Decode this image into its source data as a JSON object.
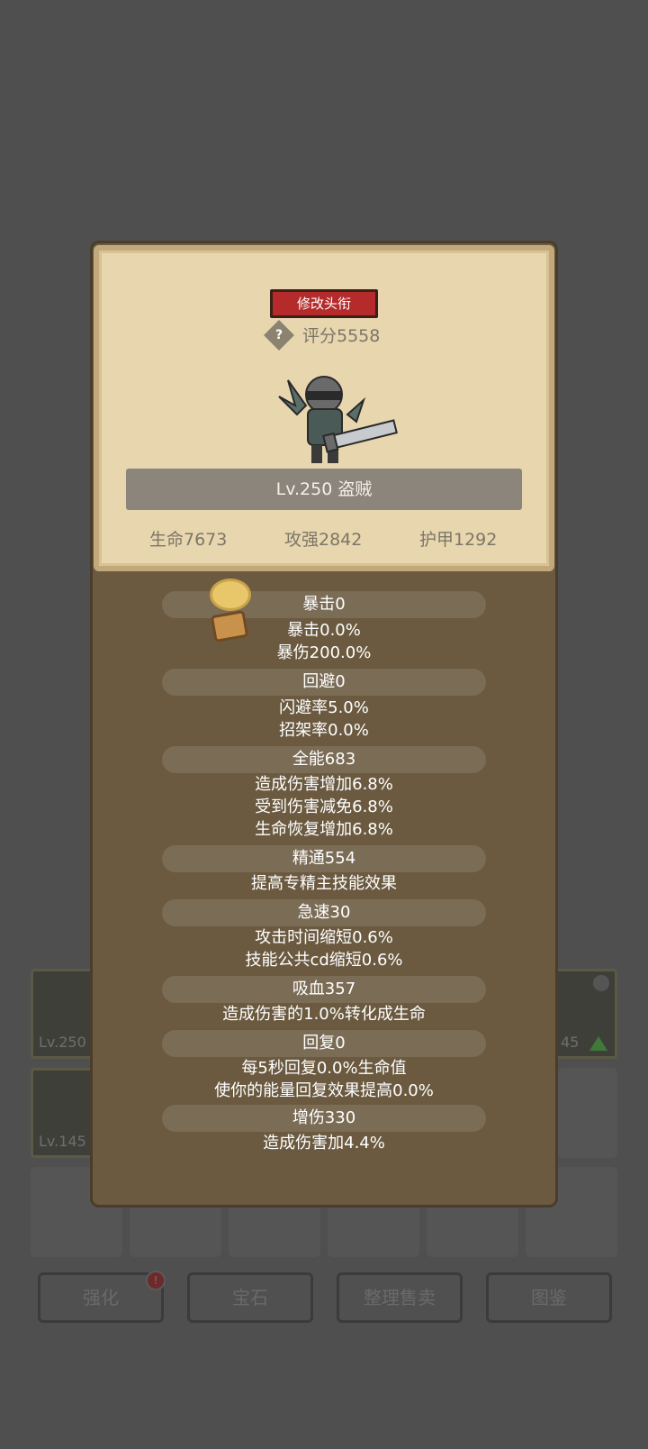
{
  "header": {
    "title_button": "修改头衔",
    "score_help": "?",
    "score": "评分5558"
  },
  "hero": {
    "level_class": "Lv.250 盗贼",
    "hp": "生命7673",
    "attack": "攻强2842",
    "armor": "护甲1292"
  },
  "attributes": [
    {
      "name": "暴击0",
      "lines": [
        "暴击0.0%",
        "暴伤200.0%"
      ]
    },
    {
      "name": "回避0",
      "lines": [
        "闪避率5.0%",
        "招架率0.0%"
      ]
    },
    {
      "name": "全能683",
      "lines": [
        "造成伤害增加6.8%",
        "受到伤害减免6.8%",
        "生命恢复增加6.8%"
      ]
    },
    {
      "name": "精通554",
      "lines": [
        "提高专精主技能效果"
      ]
    },
    {
      "name": "急速30",
      "lines": [
        "攻击时间缩短0.6%",
        "技能公共cd缩短0.6%"
      ]
    },
    {
      "name": "吸血357",
      "lines": [
        "造成伤害的1.0%转化成生命"
      ]
    },
    {
      "name": "回复0",
      "lines": [
        "每5秒回复0.0%生命值",
        "使你的能量回复效果提高0.0%"
      ]
    },
    {
      "name": "增伤330",
      "lines": [
        "造成伤害加4.4%"
      ]
    }
  ],
  "background": {
    "items": [
      {
        "level": "Lv.250"
      },
      {
        "level": "Lv.145"
      },
      {
        "level": "45"
      }
    ],
    "buttons": [
      "强化",
      "宝石",
      "整理售卖",
      "图鉴"
    ],
    "badge": "!"
  },
  "colors": {
    "title_button": "#b52a2a",
    "card": "#e7d6ae",
    "panel": "#6b5a40"
  }
}
